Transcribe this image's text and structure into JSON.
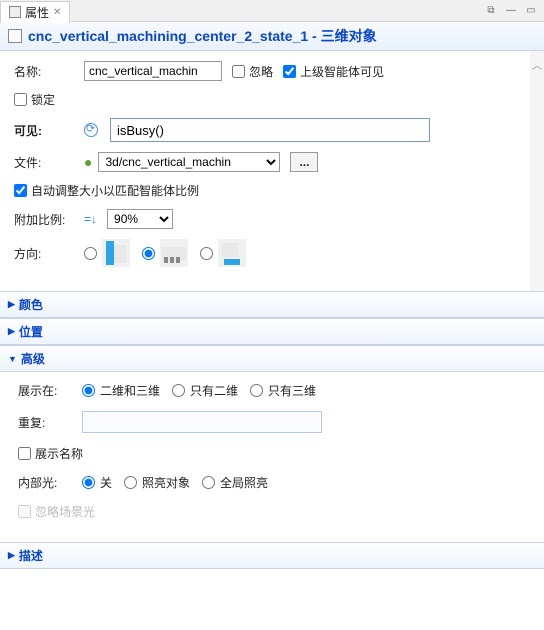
{
  "tab": {
    "title": "属性"
  },
  "header": {
    "title": "cnc_vertical_machining_center_2_state_1 - 三维对象"
  },
  "labels": {
    "name": "名称:",
    "ignore": "忽略",
    "visibleToParent": "上级智能体可见",
    "lock": "锁定",
    "visible": "可见:",
    "file": "文件:",
    "autoscale": "自动调整大小以匹配智能体比例",
    "scale": "附加比例:",
    "orientation": "方向:"
  },
  "values": {
    "name": "cnc_vertical_machin",
    "visibleExpr": "isBusy()",
    "file": "3d/cnc_vertical_machin",
    "scale": "90%",
    "ignoreChecked": false,
    "visibleToParentChecked": true,
    "lockChecked": false,
    "autoscaleChecked": true,
    "orientation": 1
  },
  "sections": {
    "color": "颜色",
    "position": "位置",
    "advanced": "高级",
    "description": "描述"
  },
  "advanced": {
    "showInLabel": "展示在:",
    "showIn": {
      "both": "二维和三维",
      "only2d": "只有二维",
      "only3d": "只有三维",
      "selected": "both"
    },
    "repeatLabel": "重复:",
    "showName": "展示名称",
    "showNameChecked": false,
    "lightLabel": "内部光:",
    "light": {
      "off": "关",
      "object": "照亮对象",
      "global": "全局照亮",
      "selected": "off"
    },
    "ignoreAmbient": "忽略场景光"
  }
}
